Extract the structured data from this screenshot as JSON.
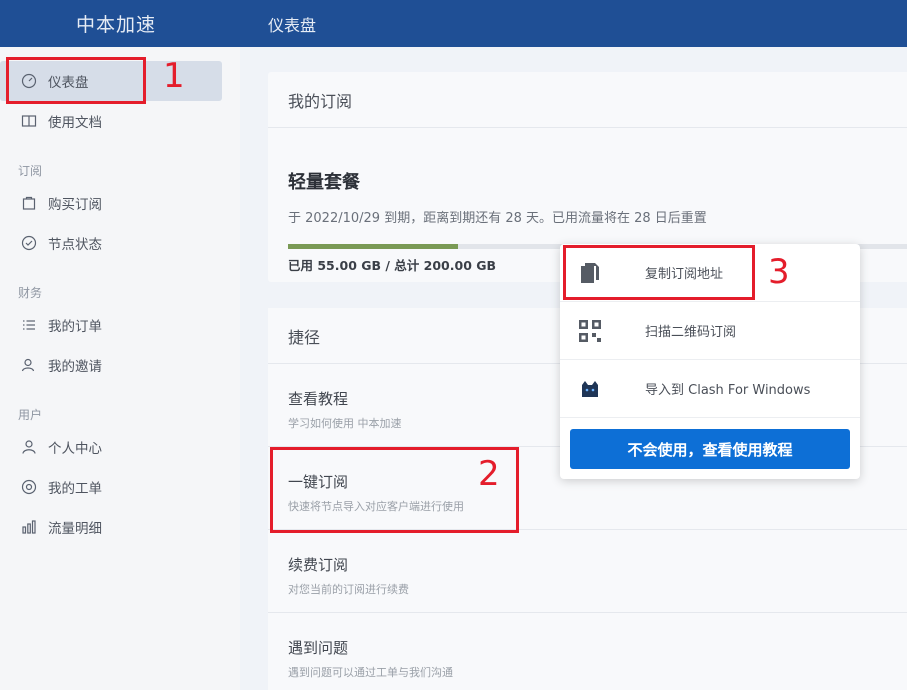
{
  "app": {
    "brand": "中本加速",
    "page_title": "仪表盘"
  },
  "sidebar": {
    "items_top": [
      {
        "label": "仪表盘",
        "icon": "dashboard-icon",
        "active": true
      },
      {
        "label": "使用文档",
        "icon": "book-icon"
      }
    ],
    "sections": [
      {
        "title": "订阅",
        "items": [
          {
            "label": "购买订阅",
            "icon": "bag-icon"
          },
          {
            "label": "节点状态",
            "icon": "check-circle-icon"
          }
        ]
      },
      {
        "title": "财务",
        "items": [
          {
            "label": "我的订单",
            "icon": "list-icon"
          },
          {
            "label": "我的邀请",
            "icon": "users-icon"
          }
        ]
      },
      {
        "title": "用户",
        "items": [
          {
            "label": "个人中心",
            "icon": "user-icon"
          },
          {
            "label": "我的工单",
            "icon": "support-icon"
          },
          {
            "label": "流量明细",
            "icon": "bar-chart-icon"
          }
        ]
      }
    ]
  },
  "subscription": {
    "header": "我的订阅",
    "plan_name": "轻量套餐",
    "info": "于 2022/10/29 到期，距离到期还有 28 天。已用流量将在 28 日后重置",
    "progress": 0.275,
    "usage": "已用 55.00 GB / 总计 200.00 GB"
  },
  "shortcuts": {
    "header": "捷径",
    "items": [
      {
        "title": "查看教程",
        "desc": "学习如何使用 中本加速"
      },
      {
        "title": "一键订阅",
        "desc": "快速将节点导入对应客户端进行使用"
      },
      {
        "title": "续费订阅",
        "desc": "对您当前的订阅进行续费"
      },
      {
        "title": "遇到问题",
        "desc": "遇到问题可以通过工单与我们沟通"
      }
    ]
  },
  "popup": {
    "items": [
      {
        "label": "复制订阅地址",
        "icon": "copy-icon"
      },
      {
        "label": "扫描二维码订阅",
        "icon": "qrcode-icon"
      },
      {
        "label": "导入到 Clash For Windows",
        "icon": "clash-cat-icon"
      }
    ],
    "button": "不会使用，查看使用教程"
  },
  "annotations": {
    "n1": "1",
    "n2": "2",
    "n3": "3"
  },
  "colors": {
    "header": "#1f4f95",
    "accent": "#0d6fd6",
    "annotation": "#e41d2b",
    "progress": "#7a9a55"
  }
}
